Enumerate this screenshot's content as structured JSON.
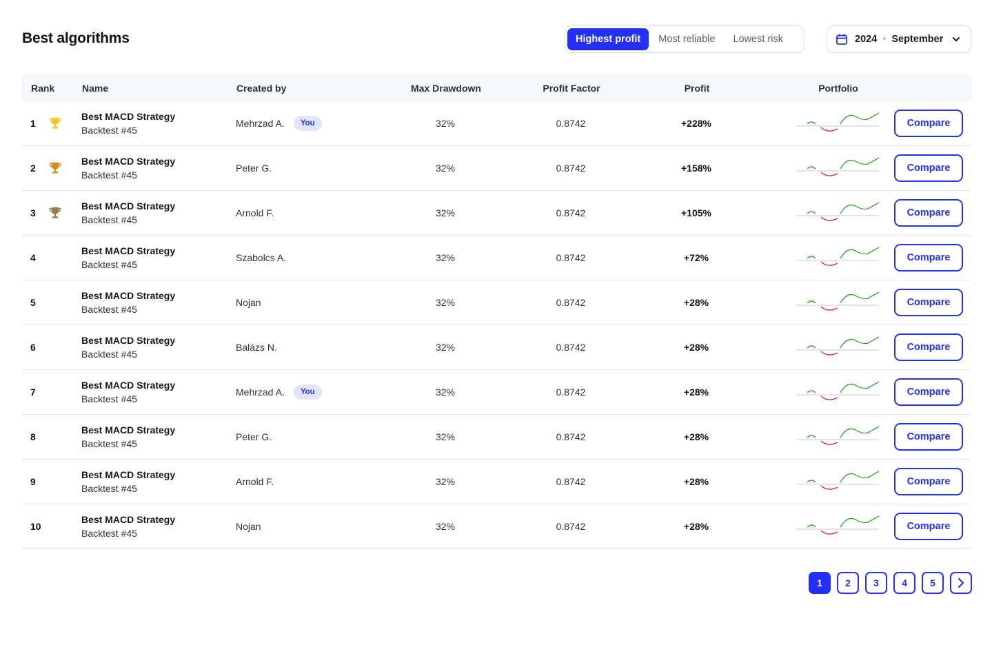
{
  "page": {
    "title": "Best algorithms"
  },
  "filters": {
    "tabs": [
      {
        "label": "Highest profit",
        "active": true
      },
      {
        "label": "Most reliable",
        "active": false
      },
      {
        "label": "Lowest risk",
        "active": false
      }
    ]
  },
  "date_picker": {
    "year": "2024",
    "month": "September",
    "icon": "calendar-icon"
  },
  "table": {
    "headers": [
      "Rank",
      "Name",
      "Created by",
      "Max Drawdown",
      "Profit Factor",
      "Profit",
      "Portfolio"
    ],
    "rows": [
      {
        "rank": "1",
        "trophy": "gold",
        "name": "Best MACD Strategy",
        "sub": "Backtest #45",
        "creator": "Mehrzad A.",
        "you": "You",
        "drawdown": "32%",
        "pf": "0.8742",
        "profit": "+228%",
        "action": "Compare"
      },
      {
        "rank": "2",
        "trophy": "silver",
        "name": "Best MACD Strategy",
        "sub": "Backtest #45",
        "creator": "Peter G.",
        "you": null,
        "drawdown": "32%",
        "pf": "0.8742",
        "profit": "+158%",
        "action": "Compare"
      },
      {
        "rank": "3",
        "trophy": "bronze",
        "name": "Best MACD Strategy",
        "sub": "Backtest #45",
        "creator": "Arnold F.",
        "you": null,
        "drawdown": "32%",
        "pf": "0.8742",
        "profit": "+105%",
        "action": "Compare"
      },
      {
        "rank": "4",
        "trophy": null,
        "name": "Best MACD Strategy",
        "sub": "Backtest #45",
        "creator": "Szabolcs A.",
        "you": null,
        "drawdown": "32%",
        "pf": "0.8742",
        "profit": "+72%",
        "action": "Compare"
      },
      {
        "rank": "5",
        "trophy": null,
        "name": "Best MACD Strategy",
        "sub": "Backtest #45",
        "creator": "Nojan",
        "you": null,
        "drawdown": "32%",
        "pf": "0.8742",
        "profit": "+28%",
        "action": "Compare"
      },
      {
        "rank": "6",
        "trophy": null,
        "name": "Best MACD Strategy",
        "sub": "Backtest #45",
        "creator": "Balázs N.",
        "you": null,
        "drawdown": "32%",
        "pf": "0.8742",
        "profit": "+28%",
        "action": "Compare"
      },
      {
        "rank": "7",
        "trophy": null,
        "name": "Best MACD Strategy",
        "sub": "Backtest #45",
        "creator": "Mehrzad A.",
        "you": "You",
        "drawdown": "32%",
        "pf": "0.8742",
        "profit": "+28%",
        "action": "Compare"
      },
      {
        "rank": "8",
        "trophy": null,
        "name": "Best MACD Strategy",
        "sub": "Backtest #45",
        "creator": "Peter G.",
        "you": null,
        "drawdown": "32%",
        "pf": "0.8742",
        "profit": "+28%",
        "action": "Compare"
      },
      {
        "rank": "9",
        "trophy": null,
        "name": "Best MACD Strategy",
        "sub": "Backtest #45",
        "creator": "Arnold F.",
        "you": null,
        "drawdown": "32%",
        "pf": "0.8742",
        "profit": "+28%",
        "action": "Compare"
      },
      {
        "rank": "10",
        "trophy": null,
        "name": "Best MACD Strategy",
        "sub": "Backtest #45",
        "creator": "Nojan",
        "you": null,
        "drawdown": "32%",
        "pf": "0.8742",
        "profit": "+28%",
        "action": "Compare"
      }
    ]
  },
  "pagination": {
    "pages": [
      "1",
      "2",
      "3",
      "4",
      "5"
    ],
    "current": "1",
    "next_icon": "chevron-right-icon"
  },
  "colors": {
    "accent": "#2231f5",
    "gain": "#2aa52a",
    "loss": "#e3262f",
    "gold": "#f5c518",
    "silver": "#d98c1a",
    "bronze": "#9c7a48"
  }
}
